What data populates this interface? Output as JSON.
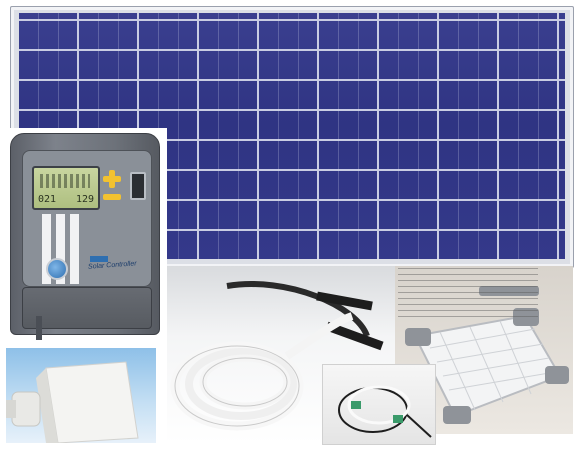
{
  "scene": {
    "description_items": [
      {
        "id": "solar-panel",
        "icon": "solar-panel-icon"
      },
      {
        "id": "charge-controller",
        "icon": "charge-controller-icon"
      },
      {
        "id": "cable-coil",
        "icon": "cable-icon"
      },
      {
        "id": "mount-kit",
        "icon": "mount-bracket-icon"
      },
      {
        "id": "junction-box",
        "icon": "junction-box-icon"
      },
      {
        "id": "connector-cable",
        "icon": "connector-icon"
      }
    ]
  },
  "controller": {
    "lcd_left": "021",
    "lcd_right": "129",
    "label": "Solar Controller"
  },
  "colors": {
    "panel_cells": "#34398a",
    "controller_body": "#6d727a",
    "controller_buttons": "#f2c230",
    "cable": "#f4f4f4",
    "mount_brackets": "#8f9399"
  }
}
